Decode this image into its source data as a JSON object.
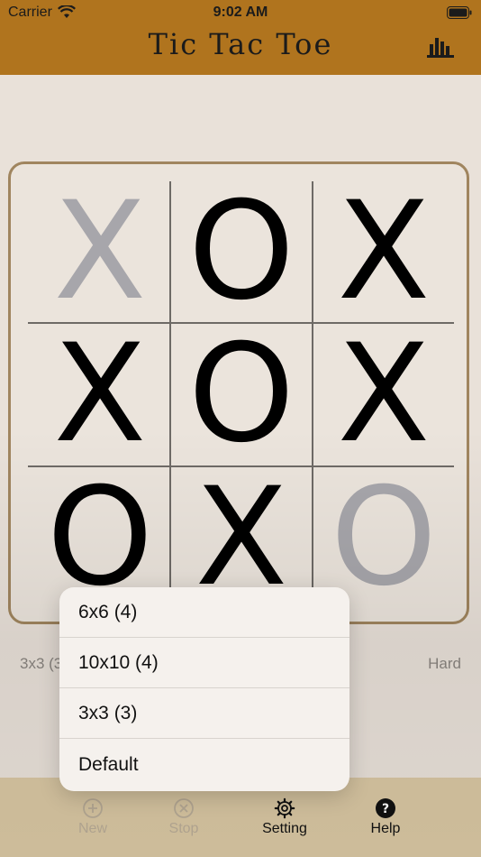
{
  "status_bar": {
    "carrier": "Carrier",
    "time": "9:02 AM"
  },
  "header": {
    "title": "Tic Tac Toe",
    "stats_icon": "bar-chart-icon"
  },
  "board": {
    "cells": [
      {
        "mark": "X",
        "faded": true
      },
      {
        "mark": "O",
        "faded": false
      },
      {
        "mark": "X",
        "faded": false
      },
      {
        "mark": "X",
        "faded": false
      },
      {
        "mark": "O",
        "faded": false
      },
      {
        "mark": "X",
        "faded": false
      },
      {
        "mark": "O",
        "faded": false
      },
      {
        "mark": "X",
        "faded": false
      },
      {
        "mark": "O",
        "faded": true
      }
    ]
  },
  "info": {
    "left": "3x3 (3",
    "right": "Hard"
  },
  "menu": {
    "items": [
      "6x6 (4)",
      "10x10 (4)",
      "3x3 (3)",
      "Default"
    ]
  },
  "tabbar": {
    "tabs": [
      {
        "label": "New",
        "icon": "plus-circle-icon",
        "enabled": false
      },
      {
        "label": "Stop",
        "icon": "x-circle-icon",
        "enabled": false
      },
      {
        "label": "Setting",
        "icon": "gear-icon",
        "enabled": true
      },
      {
        "label": "Help",
        "icon": "help-icon",
        "enabled": true
      }
    ]
  },
  "colors": {
    "header": "#b0741e",
    "background": "#e9e1d9",
    "tabbar": "#d8c6a2",
    "board_border": "#a0855f",
    "faded_mark": "#a7a6ab"
  }
}
